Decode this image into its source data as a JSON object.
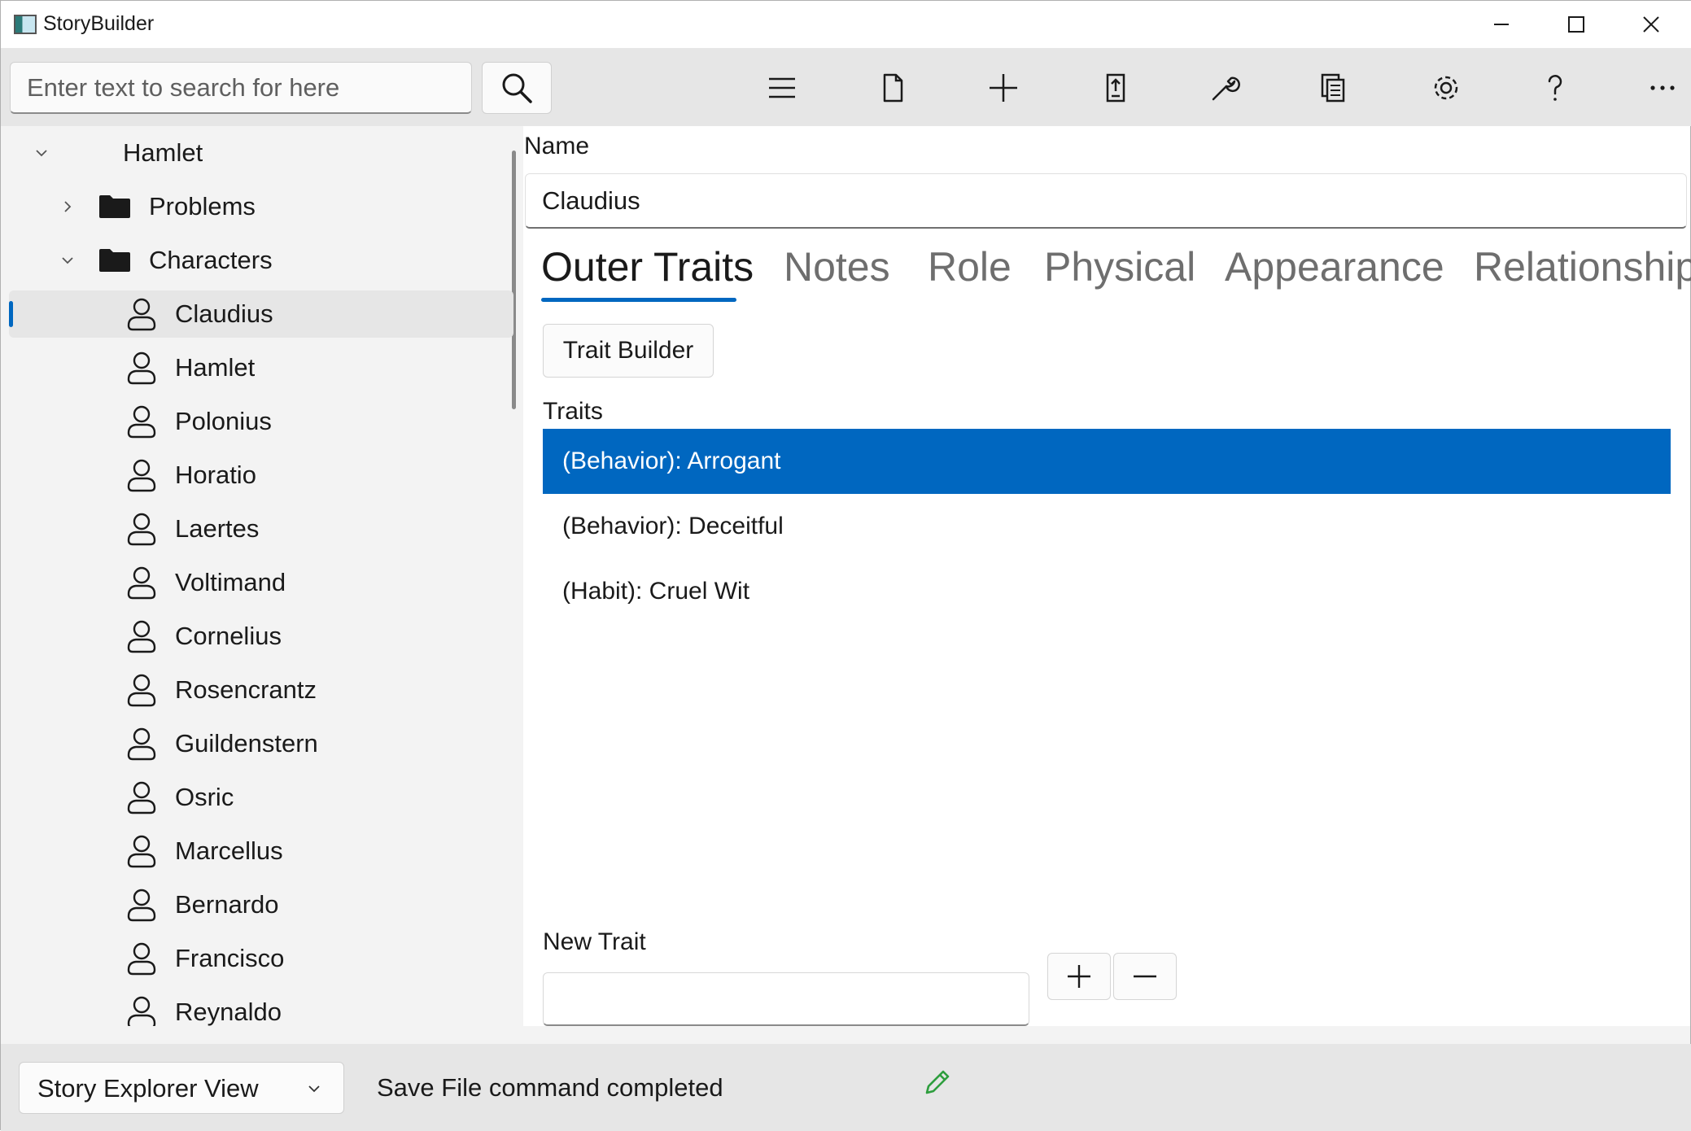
{
  "window": {
    "title": "StoryBuilder"
  },
  "toolbar": {
    "search_placeholder": "Enter text to search for here",
    "icons": [
      "menu-icon",
      "new-file-icon",
      "add-icon",
      "move-icon",
      "tools-icon",
      "report-icon",
      "settings-icon",
      "help-icon",
      "more-icon"
    ]
  },
  "tree": {
    "root": "Hamlet",
    "folders": [
      {
        "label": "Problems",
        "expanded": false
      },
      {
        "label": "Characters",
        "expanded": true
      }
    ],
    "characters": [
      "Claudius",
      "Hamlet",
      "Polonius",
      "Horatio",
      "Laertes",
      "Voltimand",
      "Cornelius",
      "Rosencrantz",
      "Guildenstern",
      "Osric",
      "Marcellus",
      "Bernardo",
      "Francisco",
      "Reynaldo"
    ],
    "selected": "Claudius"
  },
  "form": {
    "name_label": "Name",
    "name_value": "Claudius",
    "tabs": [
      "Outer Traits",
      "Notes",
      "Role",
      "Physical",
      "Appearance",
      "Relationship"
    ],
    "active_tab": "Outer Traits",
    "trait_builder_label": "Trait Builder",
    "traits_label": "Traits",
    "traits": [
      "(Behavior): Arrogant",
      "(Behavior): Deceitful",
      "(Habit): Cruel Wit"
    ],
    "selected_trait": "(Behavior): Arrogant",
    "new_trait_label": "New Trait",
    "new_trait_value": "",
    "add_symbol": "+",
    "remove_symbol": "—"
  },
  "statusbar": {
    "view_selected": "Story Explorer View",
    "message": "Save File command completed"
  },
  "colors": {
    "accent": "#0067c0",
    "pencil": "#2e9e3e"
  }
}
